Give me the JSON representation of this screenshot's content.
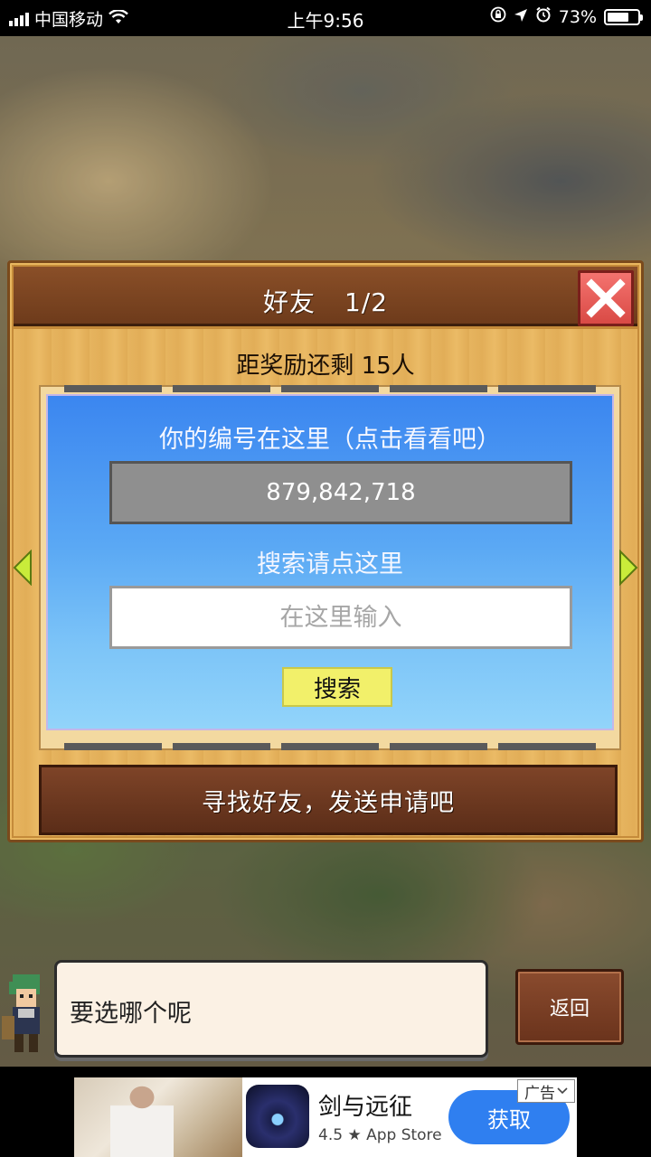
{
  "status_bar": {
    "carrier": "中国移动",
    "time": "上午9:56",
    "battery_percent": "73%",
    "battery_level": 0.73
  },
  "panel": {
    "title": "好友",
    "page": "1/2",
    "reward_text": "距奖励还剩 15人",
    "id_label": "你的编号在这里（点击看看吧）",
    "id_value": "879,842,718",
    "search_label": "搜索请点这里",
    "search_placeholder": "在这里输入",
    "search_button": "搜索",
    "find_friends_button": "寻找好友，发送申请吧"
  },
  "dialog": {
    "message": "要选哪个呢",
    "back_button": "返回"
  },
  "ad": {
    "app_name": "剑与远征",
    "rating_store": "4.5 ★ App Store",
    "get_button": "获取",
    "tag": "广告"
  },
  "colors": {
    "card_blue": "#3b86f0",
    "search_button_yellow": "#f2f06a",
    "close_red": "#e25a55",
    "wood": "#e6b45f",
    "ad_button_blue": "#2f7ff0"
  }
}
